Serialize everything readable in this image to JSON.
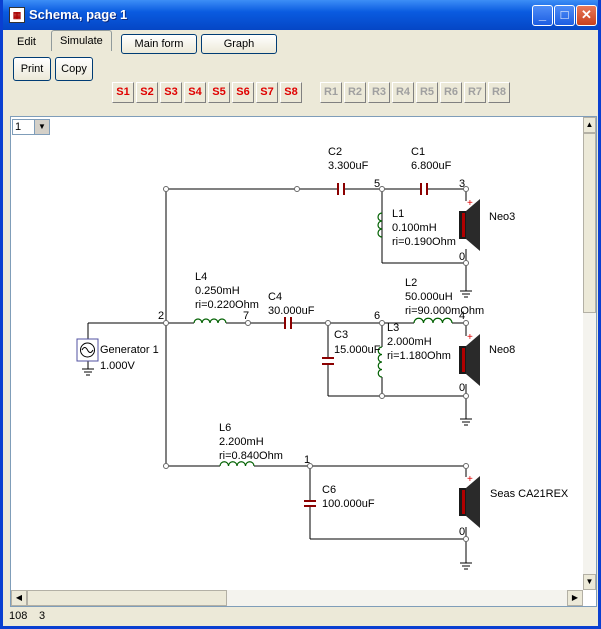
{
  "window": {
    "title": "Schema, page 1"
  },
  "menu_tabs": {
    "edit": "Edit",
    "simulate": "Simulate",
    "main_form": "Main form",
    "graph": "Graph"
  },
  "toolbar": {
    "print": "Print",
    "copy": "Copy"
  },
  "s_buttons": [
    "S1",
    "S2",
    "S3",
    "S4",
    "S5",
    "S6",
    "S7",
    "S8"
  ],
  "r_buttons": [
    "R1",
    "R2",
    "R3",
    "R4",
    "R5",
    "R6",
    "R7",
    "R8"
  ],
  "page_select": {
    "value": "1"
  },
  "status": {
    "left": "108",
    "right": "3"
  },
  "schematic": {
    "generator": {
      "name": "Generator 1",
      "value": "1.000V"
    },
    "components": {
      "C2": {
        "name": "C2",
        "value": "3.300uF"
      },
      "C1": {
        "name": "C1",
        "value": "6.800uF"
      },
      "L1": {
        "name": "L1",
        "value": "0.100mH",
        "ri": "ri=0.190Ohm"
      },
      "L4": {
        "name": "L4",
        "value": "0.250mH",
        "ri": "ri=0.220Ohm"
      },
      "C4": {
        "name": "C4",
        "value": "30.000uF"
      },
      "L2": {
        "name": "L2",
        "value": "50.000uH",
        "ri": "ri=90.000mOhm"
      },
      "C3": {
        "name": "C3",
        "value": "15.000uF"
      },
      "L3": {
        "name": "L3",
        "value": "2.000mH",
        "ri": "ri=1.180Ohm"
      },
      "L6": {
        "name": "L6",
        "value": "2.200mH",
        "ri": "ri=0.840Ohm"
      },
      "C6": {
        "name": "C6",
        "value": "100.000uF"
      }
    },
    "speakers": {
      "neo3": "Neo3",
      "neo8": "Neo8",
      "seas": "Seas CA21REX"
    },
    "nodes": {
      "n2": "2",
      "n7": "7",
      "n5": "5",
      "n3": "3",
      "n0a": "0",
      "n6": "6",
      "n4": "4",
      "n0b": "0",
      "n1": "1",
      "n0c": "0"
    },
    "polarity": "+"
  },
  "colors": {
    "title_blue": "#0a5be0",
    "red_label": "#e00000",
    "capacitor": "#8b0000",
    "coil": "#006000"
  }
}
